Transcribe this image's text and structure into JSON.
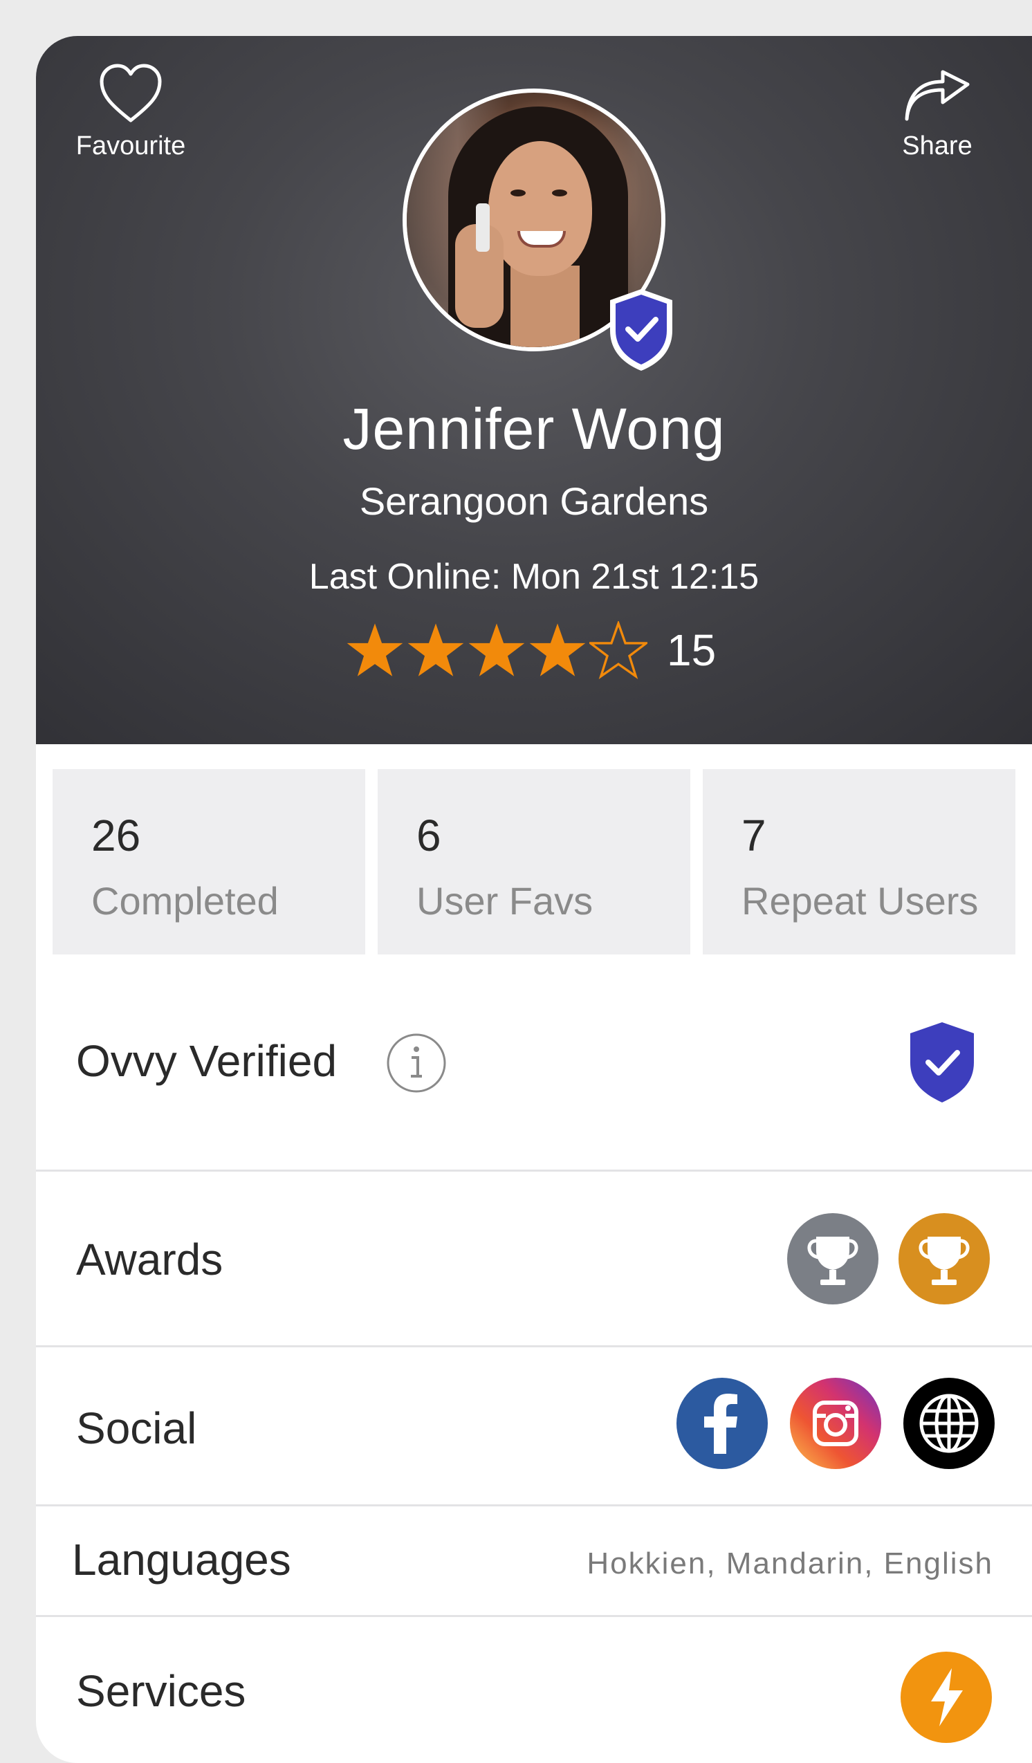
{
  "header": {
    "favourite_label": "Favourite",
    "share_label": "Share"
  },
  "profile": {
    "name": "Jennifer Wong",
    "location": "Serangoon Gardens",
    "last_online": "Last Online: Mon 21st 12:15",
    "rating": 4,
    "rating_max": 5,
    "rating_count": "15",
    "star_color": "#f28a0b",
    "verified_color": "#3d3ebd"
  },
  "stats": [
    {
      "value": "26",
      "label": "Completed"
    },
    {
      "value": "6",
      "label": "User Favs"
    },
    {
      "value": "7",
      "label": "Repeat Users"
    }
  ],
  "rows": {
    "verified": {
      "title": "Ovvy Verified",
      "info_icon": "info-icon",
      "badge_icon": "shield-check-icon"
    },
    "awards": {
      "title": "Awards",
      "items": [
        {
          "icon": "trophy-icon",
          "color": "#7b7f86"
        },
        {
          "icon": "trophy-icon",
          "color": "#d88f1f"
        }
      ]
    },
    "social": {
      "title": "Social",
      "items": [
        {
          "icon": "facebook-icon",
          "color": "#2c5aa0"
        },
        {
          "icon": "instagram-icon",
          "color": "#d23b6f"
        },
        {
          "icon": "globe-icon",
          "color": "#000000"
        }
      ]
    },
    "languages": {
      "title": "Languages",
      "value": "Hokkien, Mandarin, English"
    },
    "services": {
      "title": "Services",
      "icon": "lightning-icon",
      "color": "#f2940f"
    }
  }
}
